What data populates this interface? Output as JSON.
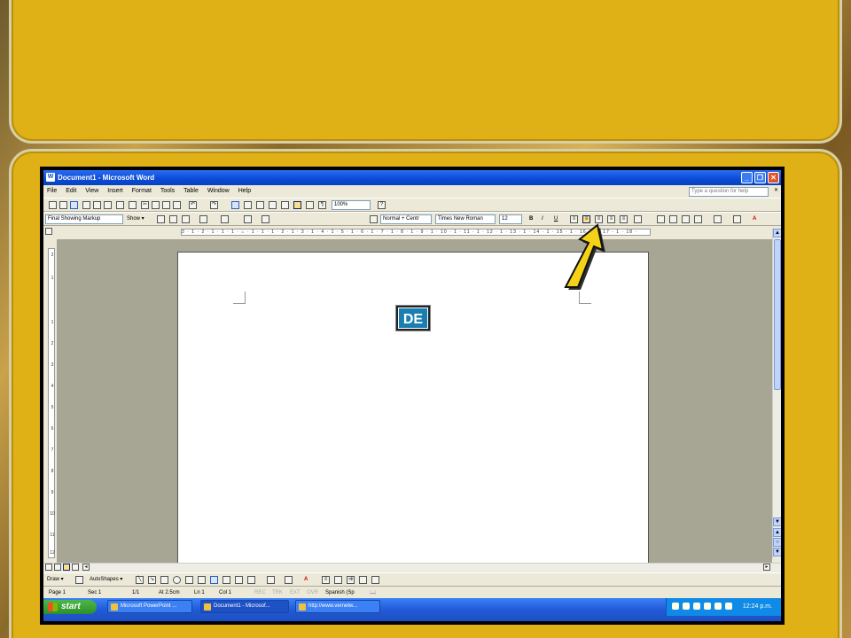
{
  "window": {
    "title": "Document1 - Microsoft Word",
    "minimize": "_",
    "restore": "❐",
    "close": "✕"
  },
  "menu": [
    "File",
    "Edit",
    "View",
    "Insert",
    "Format",
    "Tools",
    "Table",
    "Window",
    "Help"
  ],
  "help_box_placeholder": "Type a question for help",
  "toolbar1": {
    "zoom": "100%"
  },
  "toolbar2": {
    "markup": "Final Showing Markup",
    "show": "Show ▾",
    "style": "Normal + Centr",
    "font": "Times New Roman",
    "size": "12",
    "bold": "B",
    "italic": "I",
    "underline": "U"
  },
  "ruler_text": "3 · 1 · 2 · 1 · 1 · 1 · ⌂ · 1 · 1 · 1 · 2 · 1 · 3 · 1 · 4 · 1 · 5 · 1 · 6 · 1 · 7 · 1 · 8 · 1 · 9 · 1 · 10 · 1 · 11 · 1 · 12 · 1 · 13 · 1 · 14 · 1 · 15 · 1 · 16 · 1 · 17 · 1 · 18 ·",
  "vruler_ticks": [
    "2",
    "1",
    "1",
    "2",
    "3",
    "4",
    "5",
    "6",
    "7",
    "8",
    "9",
    "10",
    "11",
    "12"
  ],
  "logo_text": "DE",
  "drawbar": {
    "draw": "Draw ▾",
    "autoshapes": "AutoShapes ▾"
  },
  "status": {
    "page": "Page 1",
    "sec": "Sec 1",
    "pages": "1/1",
    "at": "At 2.5cm",
    "ln": "Ln 1",
    "col": "Col 1",
    "rec": "REC",
    "trk": "TRK",
    "ext": "EXT",
    "ovr": "OVR",
    "lang": "Spanish (Sp"
  },
  "taskbar": {
    "start": "start",
    "tasks": [
      "Microsoft PowerPoint ...",
      "Document1 - Microsof...",
      "http://www.vernetw..."
    ],
    "clock": "12:24 p.m."
  },
  "colors": {
    "panel": "#e0b017",
    "titlebar": "#0a4ad6",
    "arrow": "#f5d215"
  }
}
